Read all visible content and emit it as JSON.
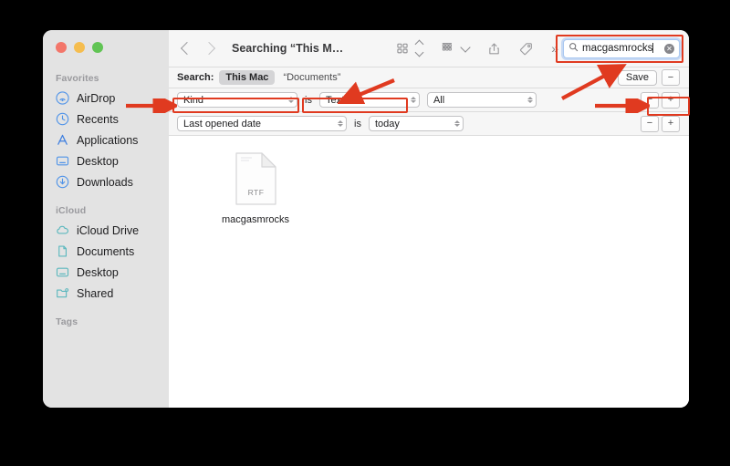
{
  "window": {
    "title": "Searching “This M…",
    "traffic_lights": [
      "close",
      "minimize",
      "zoom"
    ]
  },
  "toolbar": {
    "back_icon": "chevron-left-icon",
    "forward_icon": "chevron-right-icon",
    "view_icon": "grid-view-icon",
    "view_sort_icon": "chevron-up-down-icon",
    "group_icon": "group-by-icon",
    "group_caret_icon": "chevron-down-icon",
    "share_icon": "share-icon",
    "tag_icon": "tag-icon",
    "more_icon": "chevrons-right-icon",
    "more_label": "»"
  },
  "search": {
    "icon": "search-icon",
    "value": "macgasmrocks",
    "clear_icon": "clear-circle-icon",
    "clear_glyph": "✕"
  },
  "scope_bar": {
    "label": "Search:",
    "chips": [
      {
        "label": "This Mac",
        "selected": true
      },
      {
        "label": "“Documents”",
        "selected": false
      }
    ],
    "save_label": "Save",
    "remove_label": "−",
    "add_label": "+"
  },
  "criteria": [
    {
      "attribute": "Kind",
      "operator": "is",
      "value": "Text",
      "extra": "All",
      "remove_label": "−",
      "add_label": "+"
    },
    {
      "attribute": "Last opened date",
      "operator": "is",
      "value": "today",
      "extra": null,
      "remove_label": "−",
      "add_label": "+"
    }
  ],
  "sidebar": {
    "groups": [
      {
        "title": "Favorites",
        "items": [
          {
            "label": "AirDrop",
            "icon": "airdrop-icon",
            "color": "#4f93e8"
          },
          {
            "label": "Recents",
            "icon": "clock-icon",
            "color": "#4f93e8"
          },
          {
            "label": "Applications",
            "icon": "applications-icon",
            "color": "#3f7fe0"
          },
          {
            "label": "Desktop",
            "icon": "desktop-icon",
            "color": "#4f93e8"
          },
          {
            "label": "Downloads",
            "icon": "download-circle-icon",
            "color": "#4f93e8"
          }
        ]
      },
      {
        "title": "iCloud",
        "items": [
          {
            "label": "iCloud Drive",
            "icon": "cloud-icon",
            "color": "#5cb8be"
          },
          {
            "label": "Documents",
            "icon": "document-icon",
            "color": "#5cb8be"
          },
          {
            "label": "Desktop",
            "icon": "desktop-icon",
            "color": "#5cb8be"
          },
          {
            "label": "Shared",
            "icon": "shared-folder-icon",
            "color": "#5cb8be"
          }
        ]
      },
      {
        "title": "Tags",
        "items": []
      }
    ]
  },
  "content": {
    "files": [
      {
        "name": "macgasmrocks",
        "kind_label": "RTF",
        "icon": "rtf-file-icon"
      }
    ]
  },
  "annotations": {
    "color": "#e03a20",
    "boxes": [
      {
        "name": "search-field-highlight"
      },
      {
        "name": "kind-popup-highlight"
      },
      {
        "name": "value-popup-highlight"
      },
      {
        "name": "add-remove-row-highlight"
      }
    ],
    "arrows": [
      {
        "name": "arrow-to-value-popup"
      },
      {
        "name": "arrow-to-search-field"
      },
      {
        "name": "arrow-to-kind-popup"
      },
      {
        "name": "arrow-to-add-remove"
      }
    ]
  }
}
